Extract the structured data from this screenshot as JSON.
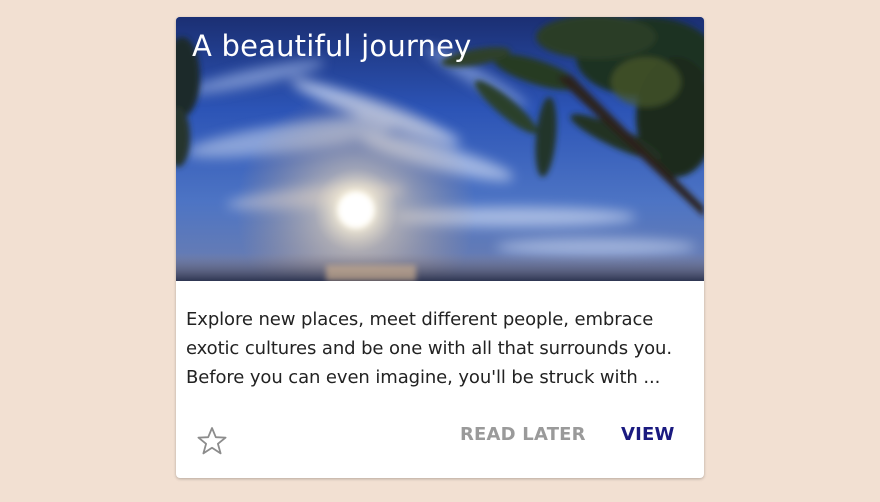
{
  "card": {
    "title": "A beautiful journey",
    "description_lines": [
      "Explore new places, meet different people, embrace",
      "exotic cultures and be one with all that surrounds you.",
      "Before you can even imagine, you'll be struck with ..."
    ],
    "actions": {
      "favorite_icon": "star-outline-icon",
      "read_later_label": "READ LATER",
      "view_label": "VIEW"
    }
  },
  "colors": {
    "page_background": "#f2e0d2",
    "card_background": "#ffffff",
    "title_text": "#ffffff",
    "body_text": "#222222",
    "secondary_action": "#9a9a9a",
    "primary_action": "#1a1a80",
    "star_outline": "#8c8c8c"
  }
}
